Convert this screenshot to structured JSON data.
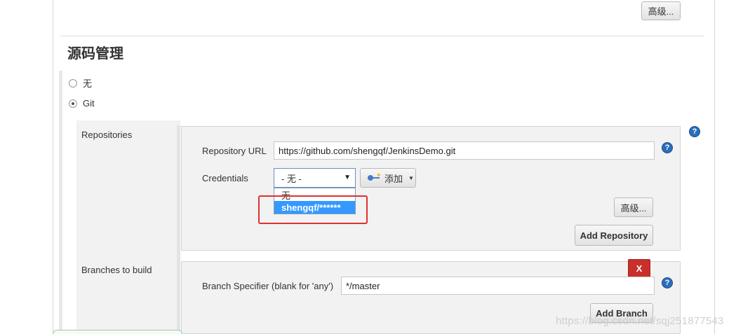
{
  "top": {
    "advanced_label": "高级..."
  },
  "section": {
    "title": "源码管理"
  },
  "scm_options": [
    {
      "label": "无",
      "checked": false
    },
    {
      "label": "Git",
      "checked": true
    }
  ],
  "repositories": {
    "label": "Repositories",
    "url_label": "Repository URL",
    "url_value": "https://github.com/shengqf/JenkinsDemo.git",
    "credentials_label": "Credentials",
    "credentials_selected": "- 无 -",
    "credentials_options": [
      "无",
      "shengqf/******"
    ],
    "add_label": "添加",
    "advanced_label": "高级...",
    "add_repository_label": "Add Repository"
  },
  "branches": {
    "label": "Branches to build",
    "specifier_label": "Branch Specifier (blank for 'any')",
    "specifier_value": "*/master",
    "delete_label": "X",
    "add_branch_label": "Add Branch"
  },
  "help": {
    "glyph": "?"
  },
  "watermark": "https://blog.csdn.net/sqj251877543"
}
